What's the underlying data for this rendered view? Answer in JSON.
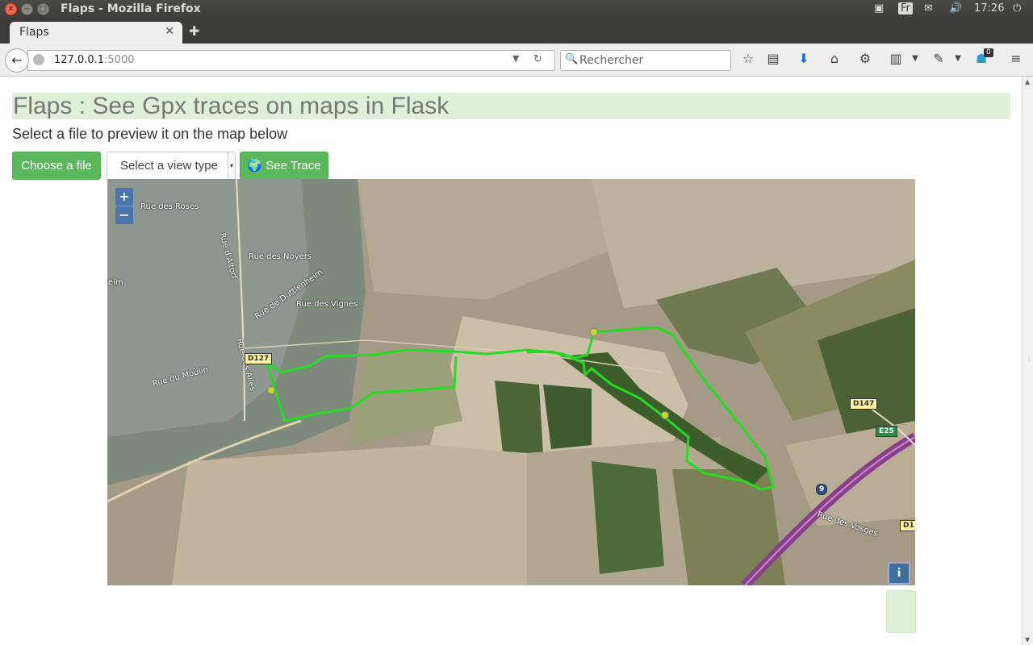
{
  "window": {
    "title": "Flaps - Mozilla Firefox",
    "clock": "17:26",
    "keyboard": "Fr"
  },
  "tabs": [
    {
      "label": "Flaps"
    }
  ],
  "nav": {
    "url_host": "127.0.0.1",
    "url_port": ":5000",
    "search_placeholder": "Rechercher",
    "notification_count": "0"
  },
  "page": {
    "heading": "Flaps : See Gpx traces on maps in Flask",
    "subtitle": "Select a file to preview it on the map below",
    "choose_file_label": "Choose a file",
    "view_type_selected": "Select a view type",
    "see_trace_label": "See Trace"
  },
  "map": {
    "zoom_in": "+",
    "zoom_out": "−",
    "info": "i",
    "street_labels": [
      "Rue des Roses",
      "Rue des Noyers",
      "Rue d'Altorf",
      "Rue de Duttlenheim",
      "Rue des Vignes",
      "Rue du Moulin",
      "Rue des Ailes",
      "Rue des Vosges",
      "eim"
    ],
    "road_shields": [
      "D127",
      "D147",
      "E25",
      "9",
      "D1"
    ],
    "trace_color": "#22dd22"
  }
}
